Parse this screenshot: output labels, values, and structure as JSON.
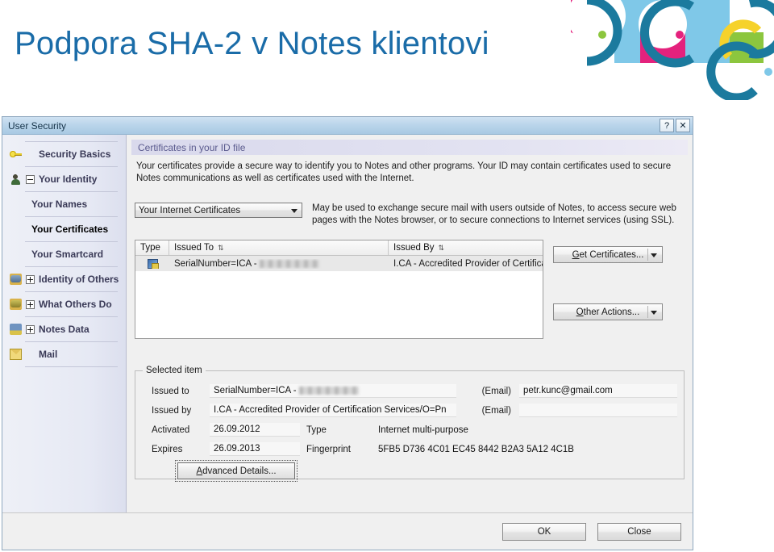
{
  "slide": {
    "title": "Podpora SHA-2 v Notes klientovi",
    "title_color": "#1a6ca8"
  },
  "logo": {
    "name": "decorative-circles-logo",
    "colors": {
      "teal": "#1b7a9e",
      "pink": "#e4227d",
      "light_blue": "#7fc8e8",
      "yellow": "#f6d22b",
      "green": "#8cc63e",
      "olive": "#9ac43a"
    }
  },
  "dialog": {
    "title": "User Security",
    "help_button": "?",
    "close_button": "✕",
    "sidebar": {
      "items": [
        {
          "label": "Security Basics",
          "icon": "key-icon",
          "expander": "none",
          "level": 0,
          "selected": false
        },
        {
          "label": "Your Identity",
          "icon": "person-icon",
          "expander": "minus",
          "level": 0,
          "selected": false
        },
        {
          "label": "Your Names",
          "icon": "none",
          "expander": "none",
          "level": 1,
          "selected": false
        },
        {
          "label": "Your Certificates",
          "icon": "none",
          "expander": "none",
          "level": 1,
          "selected": true
        },
        {
          "label": "Your Smartcard",
          "icon": "none",
          "expander": "none",
          "level": 1,
          "selected": false
        },
        {
          "label": "Identity of Others",
          "icon": "people-icon",
          "expander": "plus",
          "level": 0,
          "selected": false
        },
        {
          "label": "What Others Do",
          "icon": "people-gear-icon",
          "expander": "plus",
          "level": 0,
          "selected": false
        },
        {
          "label": "Notes Data",
          "icon": "books-icon",
          "expander": "plus",
          "level": 0,
          "selected": false
        },
        {
          "label": "Mail",
          "icon": "mail-icon",
          "expander": "none",
          "level": 0,
          "selected": false
        }
      ]
    },
    "panel": {
      "header": "Certificates in your ID file",
      "description": "Your certificates provide a secure way to identify you to Notes and other programs. Your ID may contain certificates used to secure Notes communications as well as certificates used with the Internet.",
      "cert_type_combo": {
        "value": "Your Internet Certificates",
        "caret": "chevron-down-icon"
      },
      "cert_type_description": "May be used to exchange secure mail with users outside of Notes, to access secure web pages with the Notes browser, or to secure connections to Internet services (using SSL).",
      "table": {
        "columns": [
          "Type",
          "Issued To",
          "Issued By"
        ],
        "sort_glyph": "⇅",
        "rows": [
          {
            "type_icon": "certificate-icon",
            "issued_to": "SerialNumber=ICA - ",
            "issued_to_redacted": true,
            "issued_by": "I.CA - Accredited Provider of Certification S"
          }
        ]
      },
      "buttons": {
        "get_certificates": {
          "prefix": "G",
          "label": "et Certificates..."
        },
        "other_actions": {
          "prefix": "O",
          "label": "ther Actions..."
        }
      },
      "selected_item": {
        "legend": "Selected item",
        "issued_to_label": "Issued to",
        "issued_to_value": "SerialNumber=ICA - ",
        "issued_to_redacted": true,
        "email1_label": "(Email)",
        "email1_value": "petr.kunc@gmail.com",
        "issued_by_label": "Issued by",
        "issued_by_value": "I.CA - Accredited Provider of Certification Services/O=Pn",
        "email2_label": "(Email)",
        "email2_value": "",
        "activated_label": "Activated",
        "activated_value": "26.09.2012",
        "type_label": "Type",
        "type_value": "Internet multi-purpose",
        "expires_label": "Expires",
        "expires_value": "26.09.2013",
        "fingerprint_label": "Fingerprint",
        "fingerprint_value": "5FB5 D736 4C01 EC45 8442 B2A3 5A12 4C1B",
        "advanced_details": {
          "prefix": "A",
          "label": "dvanced Details..."
        }
      }
    },
    "footer": {
      "ok_label": "OK",
      "close_label": "Close"
    }
  }
}
